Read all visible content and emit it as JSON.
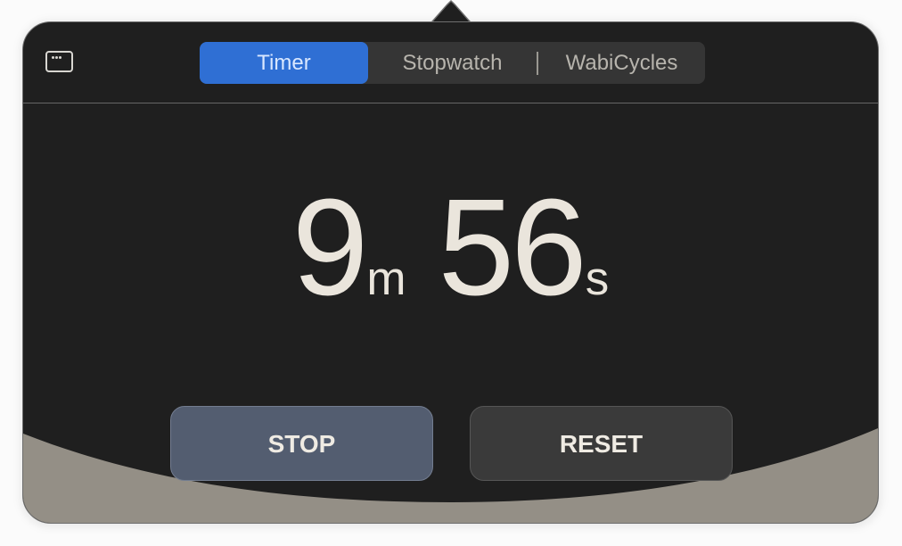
{
  "tabs": [
    {
      "label": "Timer",
      "active": true
    },
    {
      "label": "Stopwatch",
      "active": false
    },
    {
      "label": "WabiCycles",
      "active": false
    }
  ],
  "timer": {
    "minutes": "9",
    "minutes_unit": "m",
    "seconds": "56",
    "seconds_unit": "s"
  },
  "buttons": {
    "stop_label": "STOP",
    "reset_label": "RESET"
  },
  "icons": {
    "window_toggle": "window-icon"
  },
  "colors": {
    "background": "#1f1f1f",
    "accent": "#2f6fd4",
    "timer_text": "#eae5dc",
    "wave": "#948f86"
  }
}
